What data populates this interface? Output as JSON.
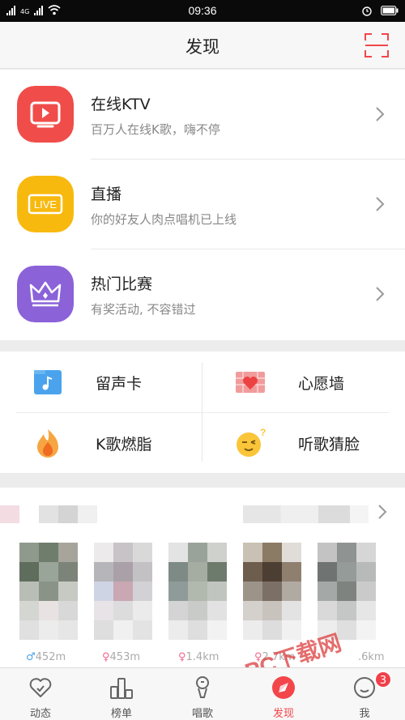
{
  "status": {
    "time": "09:36",
    "network": "4G"
  },
  "header": {
    "title": "发现"
  },
  "features": [
    {
      "title": "在线KTV",
      "subtitle": "百万人在线K歌，嗨不停",
      "icon": "ktv-play-icon",
      "color": "#f04d4a"
    },
    {
      "title": "直播",
      "subtitle": "你的好友人肉点唱机已上线",
      "icon": "live-icon",
      "color": "#f8b90f"
    },
    {
      "title": "热门比赛",
      "subtitle": "有奖活动, 不容错过",
      "icon": "crown-icon",
      "color": "#8b62d8"
    }
  ],
  "grid": [
    {
      "label": "留声卡",
      "icon": "music-card-icon"
    },
    {
      "label": "心愿墙",
      "icon": "heart-wall-icon"
    },
    {
      "label": "K歌燃脂",
      "icon": "flame-icon"
    },
    {
      "label": "听歌猜脸",
      "icon": "guess-face-icon"
    }
  ],
  "recommend": {
    "distances": [
      {
        "gender": "♂",
        "value": "452m"
      },
      {
        "gender": "♀",
        "value": "453m"
      },
      {
        "gender": "♀",
        "value": "1.4km"
      },
      {
        "gender": "♀",
        "value": "2.7km"
      },
      {
        "gender": "",
        "value": ".6km"
      }
    ]
  },
  "tabs": [
    {
      "label": "动态",
      "icon": "heart-icon"
    },
    {
      "label": "榜单",
      "icon": "ranking-icon"
    },
    {
      "label": "唱歌",
      "icon": "microphone-icon"
    },
    {
      "label": "发现",
      "icon": "discover-icon",
      "active": true
    },
    {
      "label": "我",
      "icon": "profile-icon",
      "badge": "3"
    }
  ],
  "watermark": "PC下载网",
  "colors": {
    "accent": "#f2464b",
    "text_secondary": "#888888"
  }
}
